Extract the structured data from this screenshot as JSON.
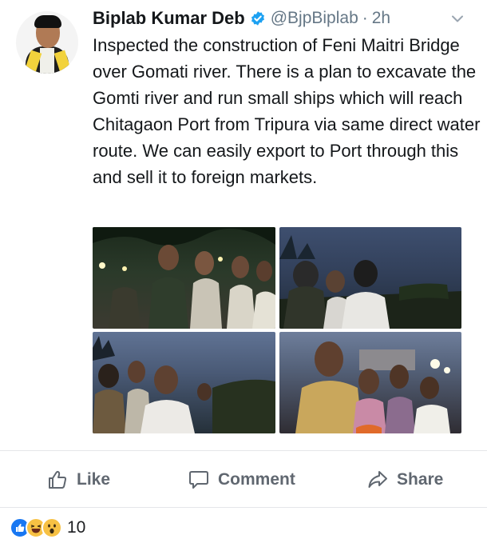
{
  "post": {
    "author_name": "Biplab Kumar Deb",
    "handle": "@BjpBiplab",
    "separator": "·",
    "time": "2h",
    "text": "Inspected the construction of Feni Maitri Bridge over Gomati river. There is a plan to excavate the Gomti river and run small ships which will reach Chitagaon Port from Tripura via same direct water route. We can easily export to Port through this and sell it to foreign markets.",
    "verified_color": "#1da1f2",
    "photos_count_shown": 4
  },
  "actions": {
    "like_label": "Like",
    "comment_label": "Comment",
    "share_label": "Share"
  },
  "reactions": {
    "types": [
      "like-icon",
      "haha-icon",
      "wow-icon"
    ],
    "count": "10",
    "like_color": "#1877f2",
    "emoji_color": "#f7c144"
  }
}
